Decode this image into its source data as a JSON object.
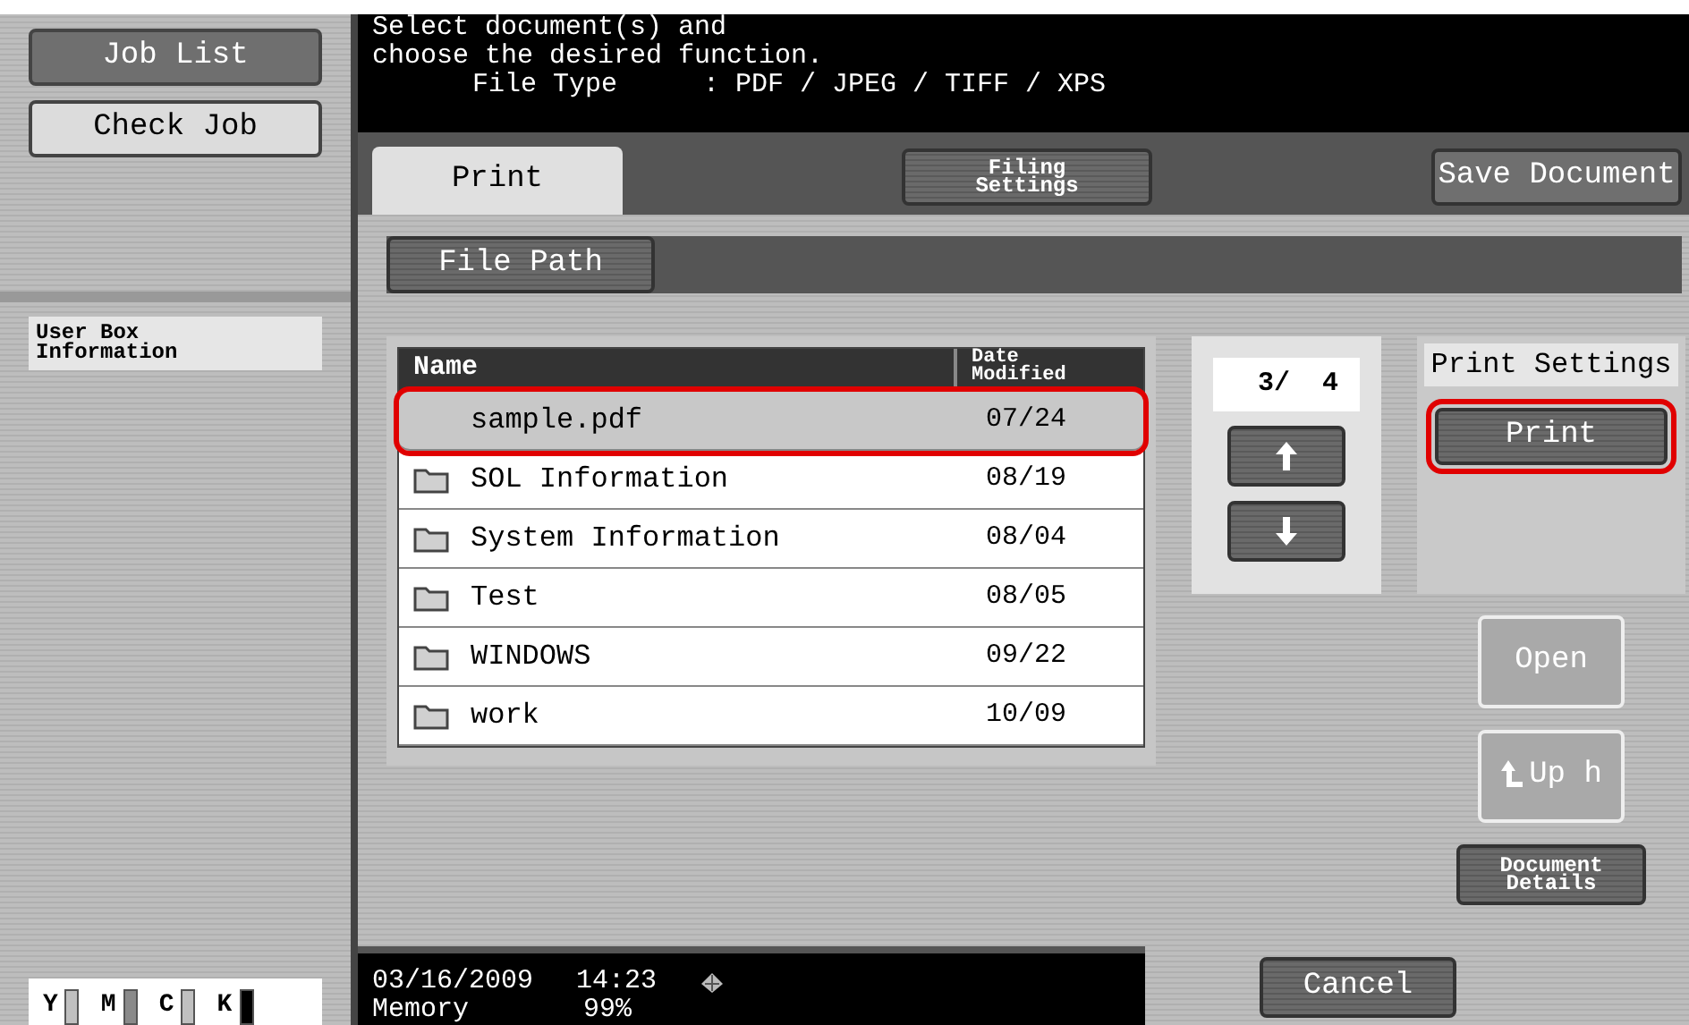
{
  "sidebar": {
    "buttons": [
      {
        "label": "Job List",
        "selected": true
      },
      {
        "label": "Check Job",
        "selected": false
      }
    ],
    "info": "User Box\nInformation",
    "toner": [
      {
        "label": "Y",
        "color": "#c0c0c0"
      },
      {
        "label": "M",
        "color": "#8a8a8a"
      },
      {
        "label": "C",
        "color": "#c0c0c0"
      },
      {
        "label": "K",
        "color": "#000000"
      }
    ]
  },
  "message": {
    "lines": [
      "Select document(s) and",
      "choose the desired function."
    ],
    "file_type_label": "File Type",
    "file_type_value": ": PDF / JPEG / TIFF / XPS"
  },
  "tabs": [
    {
      "label": "Print",
      "selected": true,
      "kind": "tab"
    },
    {
      "label": "Filing\nSettings",
      "selected": false,
      "kind": "small"
    },
    {
      "label": "Save Document",
      "selected": false,
      "kind": "tab"
    }
  ],
  "file_path": {
    "label": "File Path"
  },
  "table": {
    "columns": [
      "Name",
      "Date\nModified"
    ],
    "rows": [
      {
        "name": "sample.pdf",
        "date": "07/24",
        "kind": "file",
        "selected": true,
        "highlighted": true
      },
      {
        "name": "SOL Information",
        "date": "08/19",
        "kind": "folder",
        "selected": false,
        "highlighted": false
      },
      {
        "name": "System Information",
        "date": "08/04",
        "kind": "folder",
        "selected": false,
        "highlighted": false
      },
      {
        "name": "Test",
        "date": "08/05",
        "kind": "folder",
        "selected": false,
        "highlighted": false
      },
      {
        "name": "WINDOWS",
        "date": "09/22",
        "kind": "folder",
        "selected": false,
        "highlighted": false
      },
      {
        "name": "work",
        "date": "10/09",
        "kind": "folder",
        "selected": false,
        "highlighted": false
      }
    ]
  },
  "pager": {
    "page": "3/  4"
  },
  "print_settings": {
    "title": "Print Settings",
    "button": {
      "label": "Print",
      "highlighted": true
    }
  },
  "actions": [
    {
      "label": "Open",
      "kind": "plain",
      "disabled": true
    },
    {
      "label": "Up h",
      "kind": "up",
      "disabled": true
    },
    {
      "label": "Document\nDetails",
      "kind": "small",
      "disabled": false
    }
  ],
  "status_bar": {
    "date": "03/16/2009",
    "time": "14:23",
    "memory_label": "Memory",
    "memory_value": "99%"
  },
  "cancel": {
    "label": "Cancel"
  }
}
